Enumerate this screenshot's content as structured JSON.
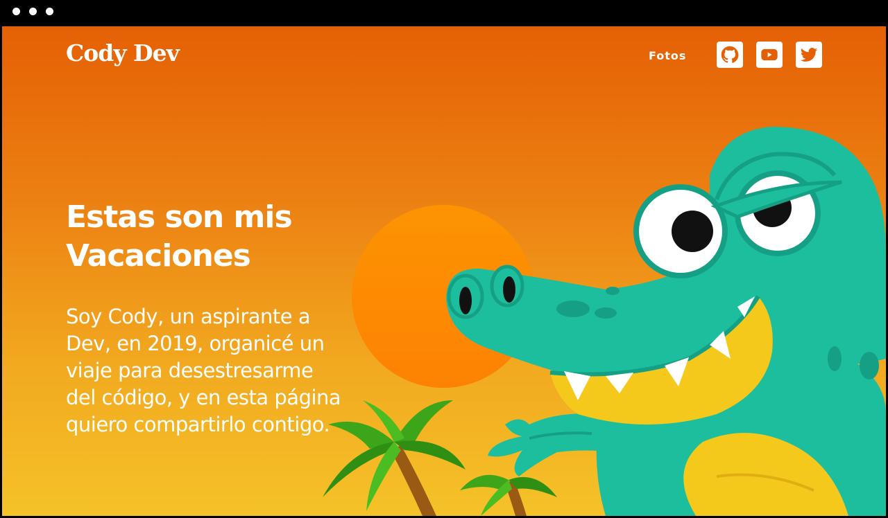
{
  "header": {
    "brand": "Cody Dev",
    "nav": [
      {
        "label": "Fotos"
      }
    ],
    "social": [
      {
        "name": "github",
        "icon": "github-icon"
      },
      {
        "name": "youtube",
        "icon": "youtube-icon"
      },
      {
        "name": "twitter",
        "icon": "twitter-icon"
      }
    ]
  },
  "hero": {
    "title": "Estas son mis Vacaciones",
    "description": "Soy Cody, un aspirante a Dev, en 2019, organicé un viaje para desestresarme del código, y en esta página quiero compartirlo contigo."
  },
  "illustration": {
    "subject": "crocodile-with-palm-trees-and-sun",
    "colors": {
      "sky_top": "#e56005",
      "sky_bottom": "#f5c228",
      "sun": "#fc8a03",
      "croc": "#1dbe9e",
      "belly": "#f5c91c",
      "palm_leaf": "#3ca51a",
      "trunk": "#9a5a14"
    }
  }
}
